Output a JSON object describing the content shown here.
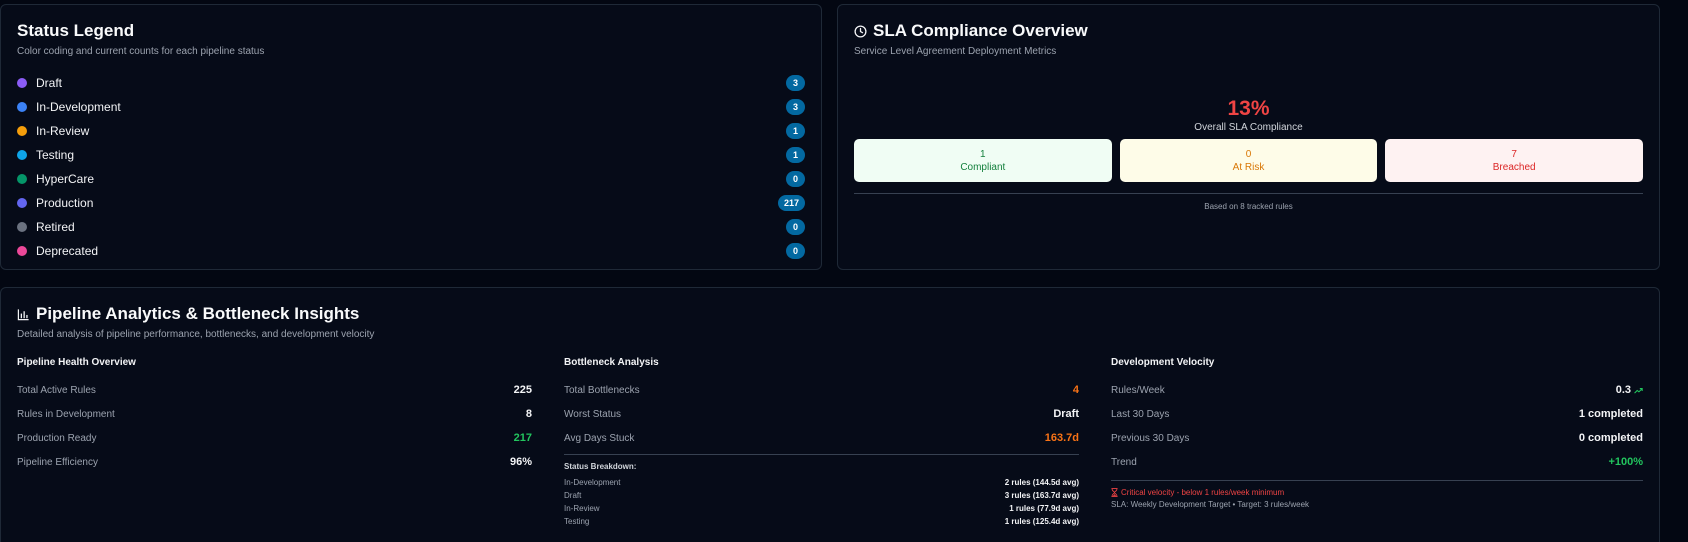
{
  "legend": {
    "title": "Status Legend",
    "subtitle": "Color coding and current counts for each pipeline status",
    "items": [
      {
        "label": "Draft",
        "count": "3",
        "color": "#8b5cf6"
      },
      {
        "label": "In-Development",
        "count": "3",
        "color": "#3b82f6"
      },
      {
        "label": "In-Review",
        "count": "1",
        "color": "#f59e0b"
      },
      {
        "label": "Testing",
        "count": "1",
        "color": "#0ea5e9"
      },
      {
        "label": "HyperCare",
        "count": "0",
        "color": "#059669"
      },
      {
        "label": "Production",
        "count": "217",
        "color": "#6366f1"
      },
      {
        "label": "Retired",
        "count": "0",
        "color": "#6b7280"
      },
      {
        "label": "Deprecated",
        "count": "0",
        "color": "#ec4899"
      }
    ]
  },
  "sla": {
    "title": "SLA Compliance Overview",
    "subtitle": "Service Level Agreement Deployment Metrics",
    "percent": "13%",
    "percent_label": "Overall SLA Compliance",
    "boxes": [
      {
        "value": "1",
        "label": "Compliant"
      },
      {
        "value": "0",
        "label": "At Risk"
      },
      {
        "value": "7",
        "label": "Breached"
      }
    ],
    "note": "Based on 8 tracked rules"
  },
  "analytics": {
    "title": "Pipeline Analytics & Bottleneck Insights",
    "subtitle": "Detailed analysis of pipeline performance, bottlenecks, and development velocity",
    "health": {
      "title": "Pipeline Health Overview",
      "metrics": [
        {
          "label": "Total Active Rules",
          "value": "225"
        },
        {
          "label": "Rules in Development",
          "value": "8"
        },
        {
          "label": "Production Ready",
          "value": "217"
        },
        {
          "label": "Pipeline Efficiency",
          "value": "96%"
        }
      ]
    },
    "bottleneck": {
      "title": "Bottleneck Analysis",
      "metrics": [
        {
          "label": "Total Bottlenecks",
          "value": "4"
        },
        {
          "label": "Worst Status",
          "value": "Draft"
        },
        {
          "label": "Avg Days Stuck",
          "value": "163.7d"
        }
      ],
      "breakdown_title": "Status Breakdown:",
      "breakdown": [
        {
          "label": "In-Development",
          "value": "2 rules (144.5d avg)"
        },
        {
          "label": "Draft",
          "value": "3 rules (163.7d avg)"
        },
        {
          "label": "In-Review",
          "value": "1 rules (77.9d avg)"
        },
        {
          "label": "Testing",
          "value": "1 rules (125.4d avg)"
        }
      ]
    },
    "velocity": {
      "title": "Development Velocity",
      "metrics": [
        {
          "label": "Rules/Week",
          "value": "0.3"
        },
        {
          "label": "Last 30 Days",
          "value": "1 completed"
        },
        {
          "label": "Previous 30 Days",
          "value": "0 completed"
        },
        {
          "label": "Trend",
          "value": "+100%"
        }
      ],
      "alert": "Critical velocity - below 1 rules/week minimum",
      "sla_note": "SLA: Weekly Development Target • Target: 3 rules/week"
    }
  }
}
